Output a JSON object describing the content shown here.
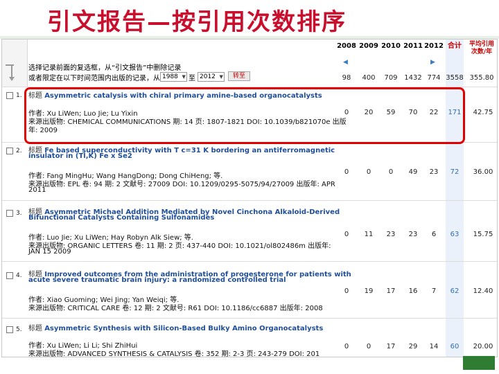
{
  "slide_title": "引文报告—按引用次数排序",
  "controls": {
    "instr_line1": "选择记录前面的复选框，从“引文报告”中删除记录",
    "instr_line2": "或者限定在以下时间范围内出版的记录，从",
    "from_year": "1988",
    "to_label": "至",
    "to_year": "2012",
    "go_label": "转至"
  },
  "years": [
    "2008",
    "2009",
    "2010",
    "2011",
    "2012"
  ],
  "total_header": "合计",
  "avg_header": "平均引用次数/年",
  "nav": {
    "left": "◀",
    "right": "▶"
  },
  "totals": [
    "98",
    "400",
    "709",
    "1432",
    "774",
    "3558",
    "355.80"
  ],
  "records": [
    {
      "num": "1.",
      "title_label": "标题",
      "title": "Asymmetric catalysis with chiral primary amine-based organocatalysts",
      "author_line": "作者: Xu LiWen; Luo Jie; Lu Yixin",
      "source_line": "来源出版物: CHEMICAL COMMUNICATIONS  期: 14  页: 1807-1821  DOI: 10.1039/b821070e  出版",
      "year_line": "年: 2009",
      "cites": [
        "0",
        "20",
        "59",
        "70",
        "22"
      ],
      "total": "171",
      "avg": "42.75"
    },
    {
      "num": "2.",
      "title_label": "标题",
      "title": "Fe based superconductivity with T c=31 K bordering an antiferromagnetic",
      "title2": "insulator in (Tl,K) Fe x Se2",
      "author_line": "作者: Fang MingHu; Wang HangDong; Dong ChiHeng; 等.",
      "source_line": "来源出版物: EPL  卷: 94  期: 2  文献号: 27009  DOI: 10.1209/0295-5075/94/27009  出版年: APR",
      "year_line": "2011",
      "cites": [
        "0",
        "0",
        "0",
        "49",
        "23"
      ],
      "total": "72",
      "avg": "36.00"
    },
    {
      "num": "3.",
      "title_label": "标题",
      "title": "Asymmetric Michael Addition Mediated by Novel Cinchona Alkaloid-Derived",
      "title2": "Bifunctional Catalysts Containing Sulfonamides",
      "author_line": "作者: Luo Jie; Xu LiWen; Hay Robyn Alk Siew; 等.",
      "source_line": "来源出版物: ORGANIC LETTERS  卷: 11  期: 2  页: 437-440  DOI: 10.1021/ol802486m  出版年:",
      "year_line": "JAN 15 2009",
      "cites": [
        "0",
        "11",
        "23",
        "23",
        "6"
      ],
      "total": "63",
      "avg": "15.75"
    },
    {
      "num": "4.",
      "title_label": "标题",
      "title": "Improved outcomes from the administration of progesterone for patients with",
      "title2": "acute severe traumatic brain injury: a randomized controlled trial",
      "author_line": "作者: Xiao Guoming; Wei Jing; Yan Weiqi; 等.",
      "source_line": "来源出版物: CRITICAL CARE  卷: 12  期: 2  文献号: R61  DOI: 10.1186/cc6887  出版年: 2008",
      "cites": [
        "0",
        "19",
        "17",
        "16",
        "7"
      ],
      "total": "62",
      "avg": "12.40"
    },
    {
      "num": "5.",
      "title_label": "标题",
      "title": "Asymmetric Synthesis with Silicon-Based Bulky Amino Organocatalysts",
      "author_line": "作者: Xu LiWen; Li Li; Shi ZhiHui",
      "source_line": "来源出版物: ADVANCED SYNTHESIS & CATALYSIS  卷: 352  期: 2-3  页: 243-279  DOI: 201",
      "cites": [
        "0",
        "0",
        "17",
        "29",
        "14"
      ],
      "total": "60",
      "avg": "20.00"
    }
  ]
}
